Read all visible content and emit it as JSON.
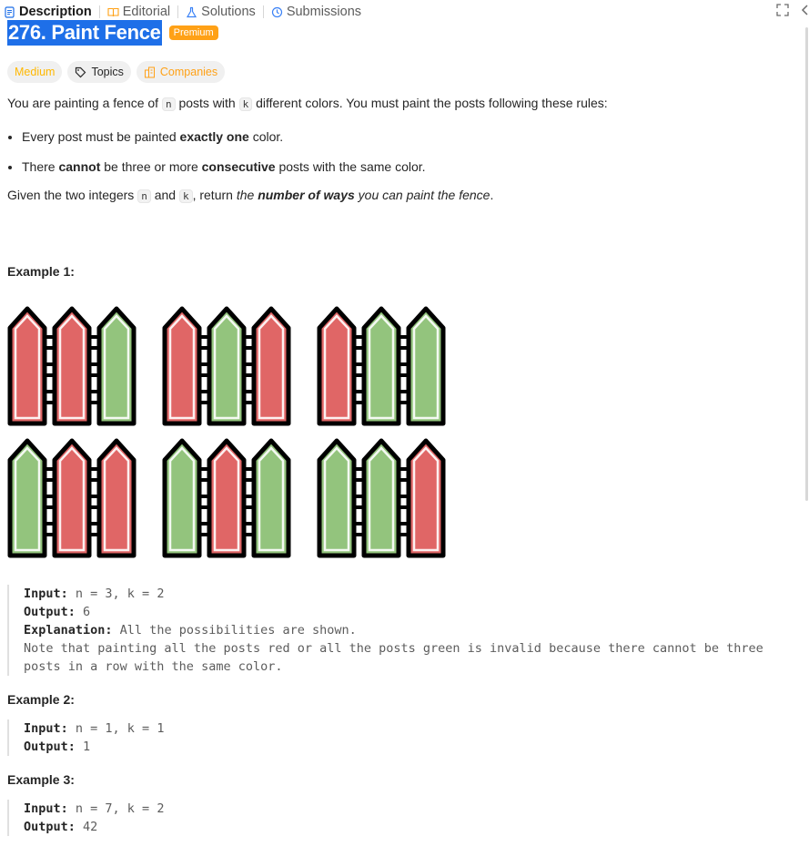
{
  "tabs": [
    {
      "label": "Description",
      "icon": "description-icon",
      "active": true
    },
    {
      "label": "Editorial",
      "icon": "book-icon",
      "active": false
    },
    {
      "label": "Solutions",
      "icon": "flask-icon",
      "active": false
    },
    {
      "label": "Submissions",
      "icon": "history-icon",
      "active": false
    }
  ],
  "problem": {
    "title": "276. Paint Fence",
    "premium_label": "Premium",
    "difficulty": "Medium",
    "topics_label": "Topics",
    "companies_label": "Companies",
    "intro": {
      "a": "You are painting a fence of ",
      "n": "n",
      "b": " posts with ",
      "k": "k",
      "c": " different colors. You must paint the posts following these rules:"
    },
    "rules": [
      {
        "pre": "Every post must be painted ",
        "bold": "exactly one",
        "post": " color."
      },
      {
        "pre": "There ",
        "bold": "cannot",
        "mid": " be three or more ",
        "bold2": "consecutive",
        "post": " posts with the same color."
      }
    ],
    "given": {
      "a": "Given the two integers ",
      "n": "n",
      "b": " and ",
      "k": "k",
      "c": ", return ",
      "d": "the ",
      "e": "number of ways",
      "f": " you can paint the fence",
      "g": "."
    }
  },
  "colors": {
    "red": "#e06666",
    "green": "#93c47d",
    "outline": "#000000",
    "accent": "#1e6fe8",
    "premium": "#ffa116"
  },
  "fences": [
    [
      "red",
      "red",
      "green"
    ],
    [
      "red",
      "green",
      "red"
    ],
    [
      "red",
      "green",
      "green"
    ],
    [
      "green",
      "red",
      "red"
    ],
    [
      "green",
      "red",
      "green"
    ],
    [
      "green",
      "green",
      "red"
    ]
  ],
  "examples": [
    {
      "title": "Example 1:",
      "input_label": "Input:",
      "input": " n = 3, k = 2",
      "output_label": "Output:",
      "output": " 6",
      "explanation_label": "Explanation:",
      "explanation": " All the possibilities are shown.",
      "note": "Note that painting all the posts red or all the posts green is invalid because there cannot be three posts in a row with the same color."
    },
    {
      "title": "Example 2:",
      "input_label": "Input:",
      "input": " n = 1, k = 1",
      "output_label": "Output:",
      "output": " 1"
    },
    {
      "title": "Example 3:",
      "input_label": "Input:",
      "input": " n = 7, k = 2",
      "output_label": "Output:",
      "output": " 42"
    }
  ]
}
